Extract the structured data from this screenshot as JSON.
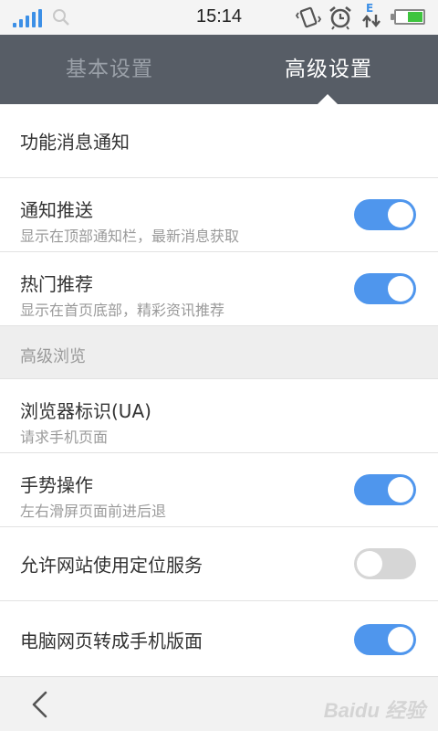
{
  "status_bar": {
    "time": "15:14",
    "signal_icon": "signal-bars-icon",
    "network_type": "E",
    "battery_level": 0.55
  },
  "tabs": [
    {
      "label": "基本设置",
      "active": false
    },
    {
      "label": "高级设置",
      "active": true
    }
  ],
  "rows": {
    "feature_notify": {
      "title": "功能消息通知"
    },
    "push_notify": {
      "title": "通知推送",
      "subtitle": "显示在顶部通知栏，最新消息获取",
      "enabled": true
    },
    "hot_recommend": {
      "title": "热门推荐",
      "subtitle": "显示在首页底部，精彩资讯推荐",
      "enabled": true
    },
    "section_advanced": {
      "label": "高级浏览"
    },
    "user_agent": {
      "title": "浏览器标识(UA)",
      "subtitle": "请求手机页面"
    },
    "gestures": {
      "title": "手势操作",
      "subtitle": "左右滑屏页面前进后退",
      "enabled": true
    },
    "location": {
      "title": "允许网站使用定位服务",
      "enabled": false
    },
    "mobile_view": {
      "title": "电脑网页转成手机版面",
      "enabled": true
    }
  },
  "colors": {
    "accent": "#4f96ed",
    "tab_bar": "#575d66",
    "toggle_off": "#d6d6d6"
  },
  "watermark": "Baidu 经验"
}
